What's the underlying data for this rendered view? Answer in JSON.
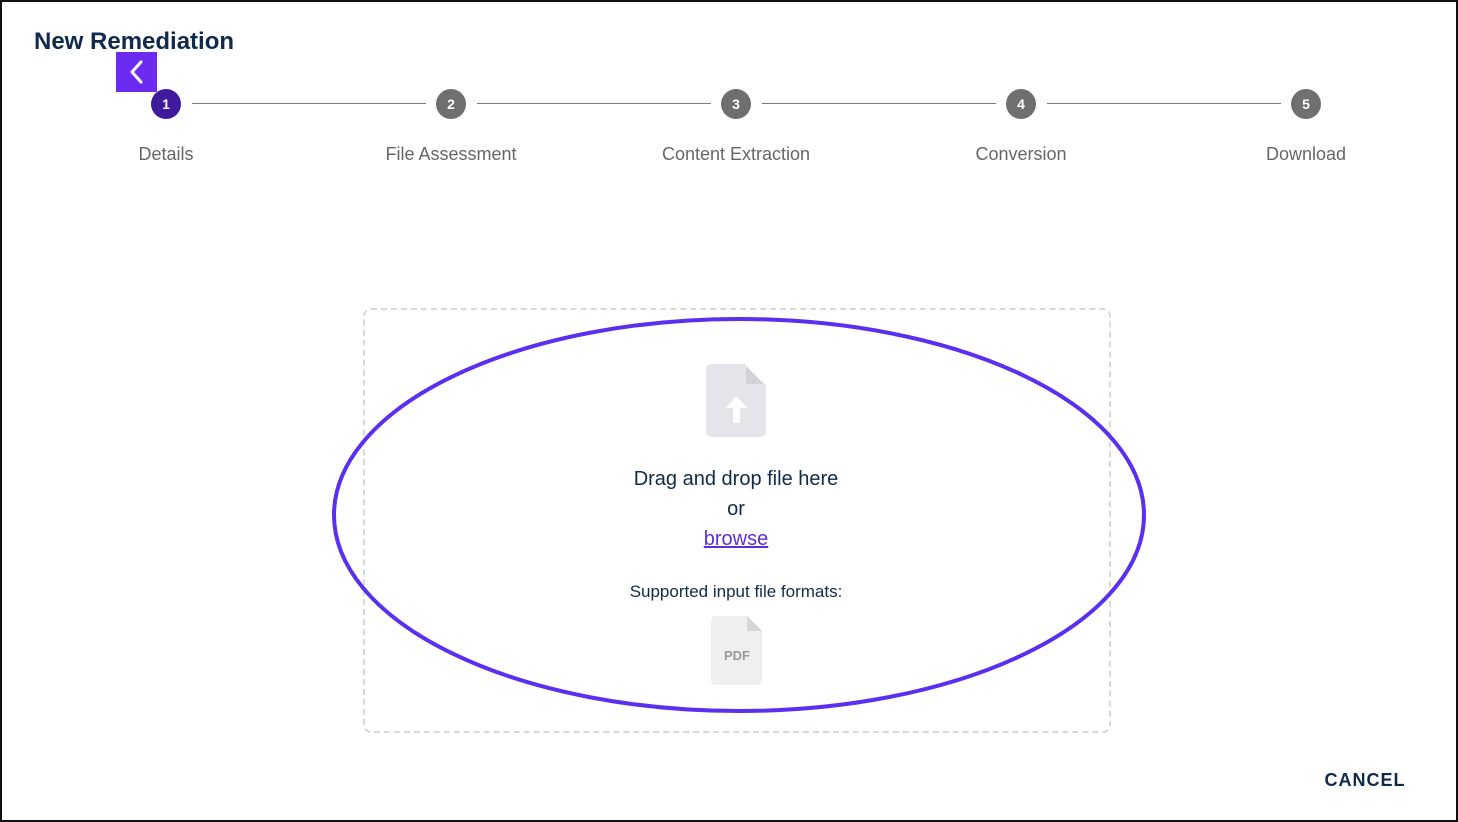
{
  "page": {
    "title": "New Remediation"
  },
  "stepper": {
    "steps": [
      {
        "number": "1",
        "label": "Details",
        "state": "active"
      },
      {
        "number": "2",
        "label": "File Assessment",
        "state": "pending"
      },
      {
        "number": "3",
        "label": "Content Extraction",
        "state": "pending"
      },
      {
        "number": "4",
        "label": "Conversion",
        "state": "pending"
      },
      {
        "number": "5",
        "label": "Download",
        "state": "pending"
      }
    ]
  },
  "upload": {
    "icon": "file-upload-icon",
    "drag_text": "Drag and drop file here",
    "or_text": "or",
    "browse_label": "browse",
    "formats_label": "Supported input file formats:",
    "formats": [
      {
        "icon": "pdf-file-icon",
        "label": "PDF"
      }
    ]
  },
  "footer": {
    "cancel_label": "CANCEL"
  },
  "colors": {
    "accent": "#6b2bf0",
    "active_step": "#3f1a9f",
    "inactive_step": "#6f6f6f",
    "title": "#0f2a4a",
    "link": "#5b2ed6",
    "highlight": "#5a2ff0"
  }
}
